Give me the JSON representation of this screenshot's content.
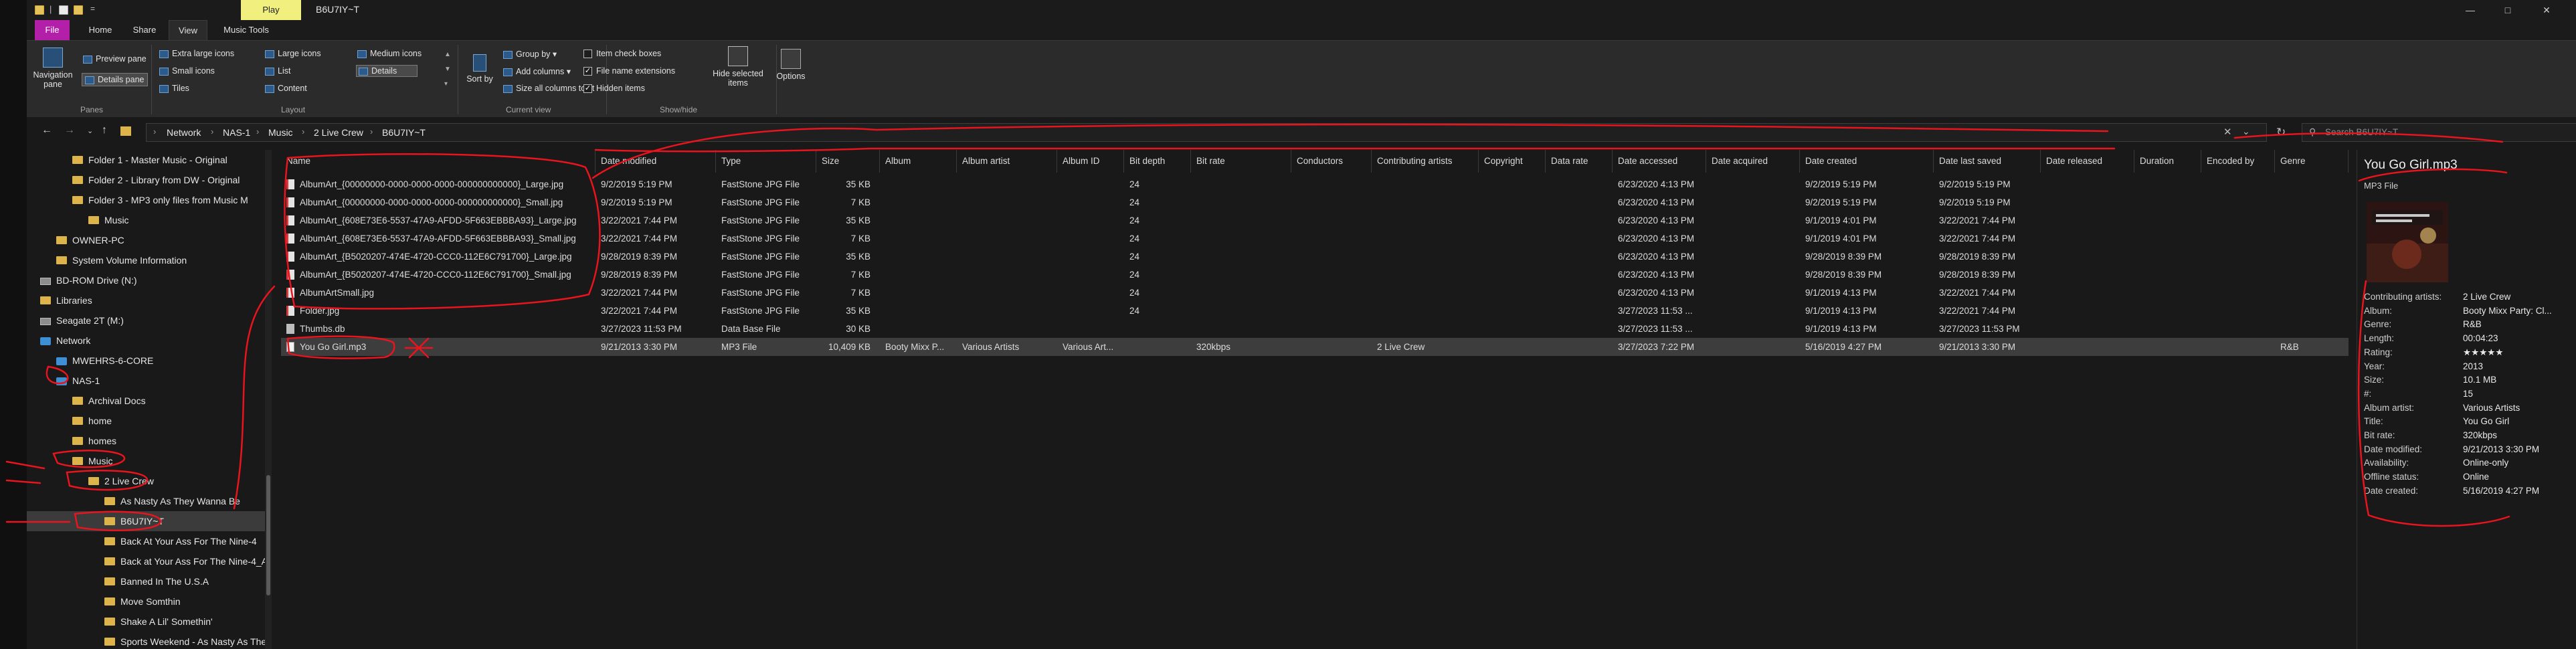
{
  "window": {
    "title": "B6U7IY~T",
    "context_tab": "Play"
  },
  "tabs": [
    "File",
    "Home",
    "Share",
    "View",
    "Music Tools"
  ],
  "ribbon": {
    "panes": {
      "navigation_pane": "Navigation pane",
      "preview_pane": "Preview pane",
      "details_pane": "Details pane",
      "group": "Panes"
    },
    "layout": {
      "items": [
        "Extra large icons",
        "Large icons",
        "Medium icons",
        "Small icons",
        "List",
        "Details",
        "Tiles",
        "Content"
      ],
      "selected": "Details",
      "group": "Layout"
    },
    "current_view": {
      "sort_by": "Sort by",
      "group_by": "Group by",
      "add_columns": "Add columns",
      "size_all": "Size all columns to fit",
      "group": "Current view"
    },
    "show_hide": {
      "item_check_boxes": "Item check boxes",
      "file_name_extensions": "File name extensions",
      "hidden_items": "Hidden items",
      "hide_selected": "Hide selected items",
      "group": "Show/hide",
      "checks": {
        "item_check_boxes": false,
        "file_name_extensions": true,
        "hidden_items": true
      }
    },
    "options": "Options"
  },
  "address": {
    "crumbs": [
      "Network",
      "NAS-1",
      "Music",
      "2 Live Crew",
      "B6U7IY~T"
    ],
    "search_placeholder": "Search B6U7IY~T"
  },
  "nav": [
    {
      "label": "Folder 1 - Master Music - Original",
      "icon": "folder",
      "indent": 2
    },
    {
      "label": "Folder 2 - Library from DW - Original",
      "icon": "folder",
      "indent": 2
    },
    {
      "label": "Folder 3 - MP3 only files from Music M",
      "icon": "folder",
      "indent": 2
    },
    {
      "label": "Music",
      "icon": "folder",
      "indent": 3
    },
    {
      "label": "OWNER-PC",
      "icon": "folder",
      "indent": 1
    },
    {
      "label": "System Volume Information",
      "icon": "folder",
      "indent": 1
    },
    {
      "label": "BD-ROM Drive (N:)",
      "icon": "drive",
      "indent": 0
    },
    {
      "label": "Libraries",
      "icon": "folder",
      "indent": 0
    },
    {
      "label": "Seagate 2T (M:)",
      "icon": "drive",
      "indent": 0
    },
    {
      "label": "Network",
      "icon": "network",
      "indent": 0
    },
    {
      "label": "MWEHRS-6-CORE",
      "icon": "network",
      "indent": 1
    },
    {
      "label": "NAS-1",
      "icon": "network",
      "indent": 1
    },
    {
      "label": "Archival Docs",
      "icon": "folder",
      "indent": 2
    },
    {
      "label": "home",
      "icon": "folder",
      "indent": 2
    },
    {
      "label": "homes",
      "icon": "folder",
      "indent": 2
    },
    {
      "label": "Music",
      "icon": "folder",
      "indent": 2
    },
    {
      "label": "2 Live Crew",
      "icon": "folder",
      "indent": 3
    },
    {
      "label": "As Nasty As They Wanna Be",
      "icon": "folder",
      "indent": 4
    },
    {
      "label": "B6U7IY~T",
      "icon": "folder",
      "indent": 4,
      "selected": true
    },
    {
      "label": "Back At Your Ass For The Nine-4",
      "icon": "folder",
      "indent": 4
    },
    {
      "label": "Back at Your Ass For The Nine-4_ADM",
      "icon": "folder",
      "indent": 4
    },
    {
      "label": "Banned In The U.S.A",
      "icon": "folder",
      "indent": 4
    },
    {
      "label": "Move Somthin",
      "icon": "folder",
      "indent": 4
    },
    {
      "label": "Shake A Lil' Somethin'",
      "icon": "folder",
      "indent": 4
    },
    {
      "label": "Sports Weekend - As Nasty As They W",
      "icon": "folder",
      "indent": 4
    }
  ],
  "columns": [
    "Name",
    "Date modified",
    "Type",
    "Size",
    "Album",
    "Album artist",
    "Album ID",
    "Bit depth",
    "Bit rate",
    "Conductors",
    "Contributing artists",
    "Copyright",
    "Data rate",
    "Date accessed",
    "Date acquired",
    "Date created",
    "Date last saved",
    "Date released",
    "Duration",
    "Encoded by",
    "Genre"
  ],
  "files": [
    {
      "name": "AlbumArt_{00000000-0000-0000-0000-000000000000}_Large.jpg",
      "icon": "jpg",
      "modified": "9/2/2019 5:19 PM",
      "type": "FastStone JPG File",
      "size": "35 KB",
      "bit_depth": "24",
      "accessed": "6/23/2020 4:13 PM",
      "created": "9/2/2019 5:19 PM",
      "last_saved": "9/2/2019 5:19 PM"
    },
    {
      "name": "AlbumArt_{00000000-0000-0000-0000-000000000000}_Small.jpg",
      "icon": "jpg",
      "modified": "9/2/2019 5:19 PM",
      "type": "FastStone JPG File",
      "size": "7 KB",
      "bit_depth": "24",
      "accessed": "6/23/2020 4:13 PM",
      "created": "9/2/2019 5:19 PM",
      "last_saved": "9/2/2019 5:19 PM"
    },
    {
      "name": "AlbumArt_{608E73E6-5537-47A9-AFDD-5F663EBBBA93}_Large.jpg",
      "icon": "jpg",
      "modified": "3/22/2021 7:44 PM",
      "type": "FastStone JPG File",
      "size": "35 KB",
      "bit_depth": "24",
      "accessed": "6/23/2020 4:13 PM",
      "created": "9/1/2019 4:01 PM",
      "last_saved": "3/22/2021 7:44 PM"
    },
    {
      "name": "AlbumArt_{608E73E6-5537-47A9-AFDD-5F663EBBBA93}_Small.jpg",
      "icon": "jpg",
      "modified": "3/22/2021 7:44 PM",
      "type": "FastStone JPG File",
      "size": "7 KB",
      "bit_depth": "24",
      "accessed": "6/23/2020 4:13 PM",
      "created": "9/1/2019 4:01 PM",
      "last_saved": "3/22/2021 7:44 PM"
    },
    {
      "name": "AlbumArt_{B5020207-474E-4720-CCC0-112E6C791700}_Large.jpg",
      "icon": "jpg",
      "modified": "9/28/2019 8:39 PM",
      "type": "FastStone JPG File",
      "size": "35 KB",
      "bit_depth": "24",
      "accessed": "6/23/2020 4:13 PM",
      "created": "9/28/2019 8:39 PM",
      "last_saved": "9/28/2019 8:39 PM"
    },
    {
      "name": "AlbumArt_{B5020207-474E-4720-CCC0-112E6C791700}_Small.jpg",
      "icon": "jpg",
      "modified": "9/28/2019 8:39 PM",
      "type": "FastStone JPG File",
      "size": "7 KB",
      "bit_depth": "24",
      "accessed": "6/23/2020 4:13 PM",
      "created": "9/28/2019 8:39 PM",
      "last_saved": "9/28/2019 8:39 PM"
    },
    {
      "name": "AlbumArtSmall.jpg",
      "icon": "jpg",
      "modified": "3/22/2021 7:44 PM",
      "type": "FastStone JPG File",
      "size": "7 KB",
      "bit_depth": "24",
      "accessed": "6/23/2020 4:13 PM",
      "created": "9/1/2019 4:13 PM",
      "last_saved": "3/22/2021 7:44 PM"
    },
    {
      "name": "Folder.jpg",
      "icon": "jpg",
      "modified": "3/22/2021 7:44 PM",
      "type": "FastStone JPG File",
      "size": "35 KB",
      "bit_depth": "24",
      "accessed": "3/27/2023 11:53 ...",
      "created": "9/1/2019 4:13 PM",
      "last_saved": "3/22/2021 7:44 PM"
    },
    {
      "name": "Thumbs.db",
      "icon": "db",
      "modified": "3/27/2023 11:53 PM",
      "type": "Data Base File",
      "size": "30 KB",
      "accessed": "3/27/2023 11:53 ...",
      "created": "9/1/2019 4:13 PM",
      "last_saved": "3/27/2023 11:53 PM"
    },
    {
      "name": "You Go Girl.mp3",
      "icon": "mp3",
      "modified": "9/21/2013 3:30 PM",
      "type": "MP3 File",
      "size": "10,409 KB",
      "album": "Booty Mixx P...",
      "album_artist": "Various Artists",
      "album_id": "Various Art...",
      "bit_rate": "320kbps",
      "contributing": "2 Live Crew",
      "accessed": "3/27/2023 7:22 PM",
      "created": "5/16/2019 4:27 PM",
      "last_saved": "9/21/2013 3:30 PM",
      "genre": "R&B",
      "selected": true
    }
  ],
  "details": {
    "title": "You Go Girl.mp3",
    "type": "MP3 File",
    "props": [
      {
        "label": "Contributing artists:",
        "value": "2 Live Crew"
      },
      {
        "label": "Album:",
        "value": "Booty Mixx Party: Cl..."
      },
      {
        "label": "Genre:",
        "value": "R&B"
      },
      {
        "label": "Length:",
        "value": "00:04:23"
      },
      {
        "label": "Rating:",
        "value": "★★★★★"
      },
      {
        "label": "Year:",
        "value": "2013"
      },
      {
        "label": "Size:",
        "value": "10.1 MB"
      },
      {
        "label": "#:",
        "value": "15"
      },
      {
        "label": "Album artist:",
        "value": "Various Artists"
      },
      {
        "label": "Title:",
        "value": "You Go Girl"
      },
      {
        "label": "Bit rate:",
        "value": "320kbps"
      },
      {
        "label": "Date modified:",
        "value": "9/21/2013 3:30 PM"
      },
      {
        "label": "Availability:",
        "value": "Online-only"
      },
      {
        "label": "Offline status:",
        "value": "Online"
      },
      {
        "label": "Date created:",
        "value": "5/16/2019 4:27 PM"
      }
    ]
  },
  "colors": {
    "file_tab": "#b41fa9",
    "context_band": "#f1f07f",
    "annotation": "#e8141e",
    "folder": "#dcb44a"
  }
}
